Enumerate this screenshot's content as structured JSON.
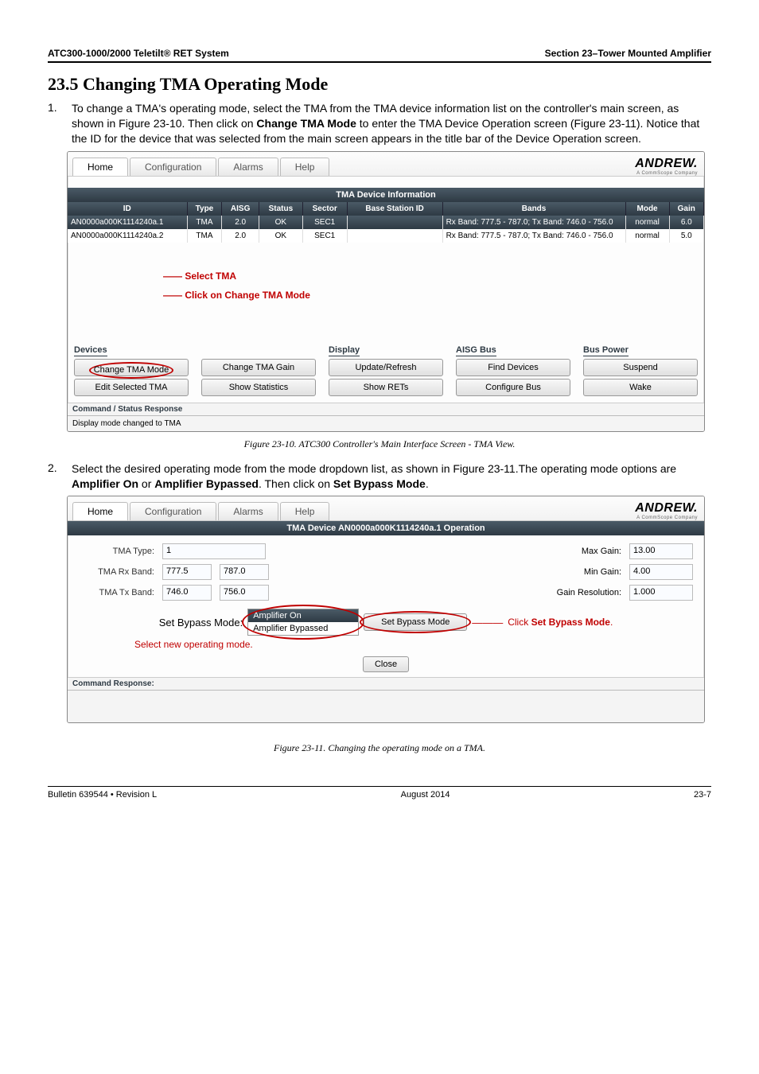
{
  "topbar": {
    "left": "ATC300-1000/2000 Teletilt® RET System",
    "right": "Section 23–Tower Mounted Amplifier"
  },
  "heading": "23.5 Changing TMA Operating Mode",
  "step1": {
    "num": "1.",
    "text_a": "To change a TMA's operating mode, select the TMA from the TMA device information list on the controller's main screen, as shown in Figure 23-10. Then click on ",
    "bold_a": "Change TMA Mode",
    "text_b": " to enter the TMA Device Operation screen (Figure 23-11). Notice that the ID for the device that was selected from the main screen appears in the title bar of the Device Operation screen."
  },
  "fig10": {
    "tabs": {
      "home": "Home",
      "config": "Configuration",
      "alarms": "Alarms",
      "help": "Help"
    },
    "brand": "ANDREW.",
    "brand_sub": "A CommScope Company",
    "section_title": "TMA Device Information",
    "headers": {
      "id": "ID",
      "type": "Type",
      "aisg": "AISG",
      "status": "Status",
      "sector": "Sector",
      "base": "Base Station ID",
      "bands": "Bands",
      "mode": "Mode",
      "gain": "Gain"
    },
    "row1": {
      "id": "AN0000a000K1114240a.1",
      "type": "TMA",
      "aisg": "2.0",
      "status": "OK",
      "sector": "SEC1",
      "base": "",
      "bands": "Rx Band: 777.5 - 787.0; Tx Band: 746.0 - 756.0",
      "mode": "normal",
      "gain": "6.0"
    },
    "row2": {
      "id": "AN0000a000K1114240a.2",
      "type": "TMA",
      "aisg": "2.0",
      "status": "OK",
      "sector": "SEC1",
      "base": "",
      "bands": "Rx Band: 777.5 - 787.0; Tx Band: 746.0 - 756.0",
      "mode": "normal",
      "gain": "5.0"
    },
    "annot1_a": "Select ",
    "annot1_b": "TMA",
    "annot2_a": "Click on ",
    "annot2_b": "Change TMA Mode",
    "groups": {
      "devices": "Devices",
      "display": "Display",
      "aisg_bus": "AISG Bus",
      "bus_power": "Bus Power",
      "change_mode": "Change TMA Mode",
      "change_gain": "Change TMA Gain",
      "edit_sel": "Edit Selected TMA",
      "show_stats": "Show Statistics",
      "update": "Update/Refresh",
      "show_rets": "Show RETs",
      "find": "Find Devices",
      "configure": "Configure Bus",
      "suspend": "Suspend",
      "wake": "Wake"
    },
    "status_hdr": "Command / Status Response",
    "status_msg": "Display mode changed to TMA"
  },
  "caption10": "Figure 23-10.   ATC300 Controller's Main Interface Screen - TMA View.",
  "step2": {
    "num": "2.",
    "text_a": "Select the desired operating mode from the mode dropdown list, as shown in Figure 23-11.The operating mode options are ",
    "bold_a": "Amplifier On",
    "text_b": " or ",
    "bold_b": "Amplifier Bypassed",
    "text_c": ".  Then click on ",
    "bold_c": "Set Bypass Mode",
    "text_d": "."
  },
  "fig11": {
    "tabs": {
      "home": "Home",
      "config": "Configuration",
      "alarms": "Alarms",
      "help": "Help"
    },
    "brand": "ANDREW.",
    "brand_sub": "A CommScope Company",
    "section_title": "TMA Device AN0000a000K1114240a.1 Operation",
    "tma_type_lbl": "TMA Type:",
    "tma_type_val": "1",
    "rx_lbl": "TMA Rx Band:",
    "rx_val": "777.5",
    "rx_val2": "787.0",
    "tx_lbl": "TMA Tx Band:",
    "tx_val": "746.0",
    "tx_val2": "756.0",
    "max_gain_lbl": "Max Gain:",
    "max_gain_val": "13.00",
    "min_gain_lbl": "Min Gain:",
    "min_gain_val": "4.00",
    "res_lbl": "Gain Resolution:",
    "res_val": "1.000",
    "set_mode_lbl": "Set Bypass Mode:",
    "dd_sel": "Amplifier On",
    "dd_opt": "Amplifier Bypassed",
    "set_btn": "Set Bypass Mode",
    "annot_a": "Click ",
    "annot_b": "Set Bypass Mode",
    "annot_c": ".",
    "annot_left": "Select new operating mode.",
    "close": "Close",
    "resp_hdr": "Command Response:"
  },
  "caption11": "Figure 23-11.  Changing the operating mode on a TMA.",
  "footer": {
    "left": "Bulletin 639544  •  Revision L",
    "center": "August 2014",
    "right": "23-7"
  }
}
